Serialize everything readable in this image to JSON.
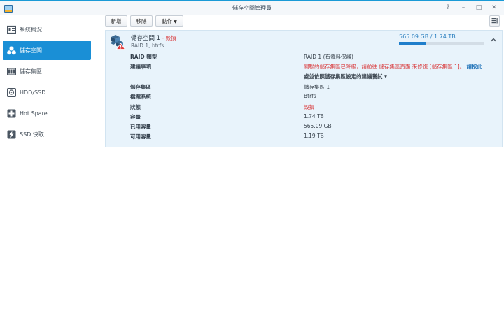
{
  "window": {
    "title": "儲存空間管理員",
    "controls": [
      "?",
      "–",
      "□",
      "✕"
    ]
  },
  "sidebar": {
    "items": [
      {
        "label": "系統概況",
        "icon": "overview-icon",
        "active": false
      },
      {
        "label": "儲存空間",
        "icon": "storage-volume-icon",
        "active": true
      },
      {
        "label": "儲存集區",
        "icon": "storage-pool-icon",
        "active": false
      },
      {
        "label": "HDD/SSD",
        "icon": "hdd-icon",
        "active": false
      },
      {
        "label": "Hot Spare",
        "icon": "hot-spare-icon",
        "active": false
      },
      {
        "label": "SSD 快取",
        "icon": "ssd-cache-icon",
        "active": false
      }
    ]
  },
  "toolbar": {
    "create_label": "新增",
    "remove_label": "移除",
    "action_label": "動作"
  },
  "volume": {
    "name": "儲存空間 1",
    "status_sep": " - ",
    "status": "毀損",
    "subtitle": "RAID 1, btrfs",
    "usage_text": "565.09 GB / 1.74 TB",
    "usage_fraction": 0.317,
    "details": {
      "raid_type_label": "RAID 類型",
      "raid_type_value": "RAID 1 (有資料保護)",
      "suggestion_label": "建議事項",
      "suggestion_line1_a": "關聯的儲存集區已降級，請前往 儲存集區頁面 來修復 [儲存集區 1]。",
      "suggestion_line1_link": "請按此",
      "suggestion_line2": "處並依照儲存集區設定的建議嘗試 ▾",
      "pool_label": "儲存集區",
      "pool_value": "儲存集區 1",
      "fs_label": "檔案系統",
      "fs_value": "Btrfs",
      "state_label": "狀態",
      "state_value": "毀損",
      "capacity_label": "容量",
      "capacity_value": "1.74 TB",
      "used_label": "已用容量",
      "used_value": "565.09 GB",
      "available_label": "可用容量",
      "available_value": "1.19 TB"
    }
  },
  "colors": {
    "accent": "#1a8fd6",
    "warning": "#d9383a",
    "panel_bg": "#e8f3fb"
  }
}
